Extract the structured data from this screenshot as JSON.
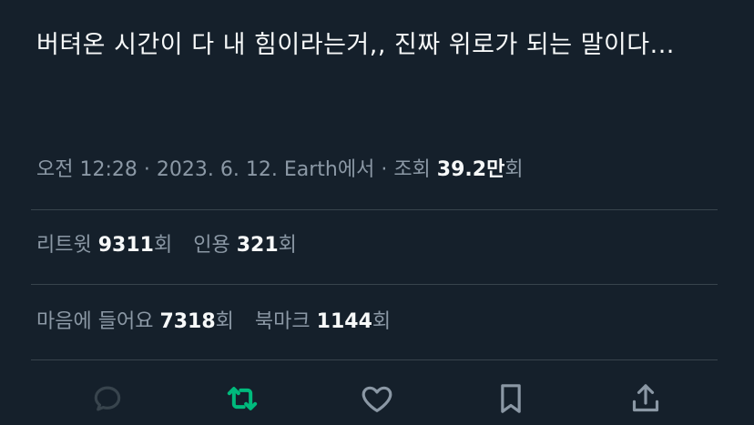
{
  "tweet": {
    "text": "버텨온 시간이 다 내 힘이라는거,, 진짜 위로가 되는 말이다..."
  },
  "meta": {
    "time": "오전 12:28",
    "separator": "·",
    "date": "2023. 6. 12.",
    "source": "Earth에서",
    "views_label": "조회",
    "views_value": "39.2만",
    "views_suffix": "회"
  },
  "stats": {
    "retweets": {
      "label": "리트윗",
      "value": "9311",
      "suffix": "회"
    },
    "quotes": {
      "label": "인용",
      "value": "321",
      "suffix": "회"
    },
    "likes": {
      "label": "마음에 들어요",
      "value": "7318",
      "suffix": "회"
    },
    "bookmarks": {
      "label": "북마크",
      "value": "1144",
      "suffix": "회"
    }
  },
  "actions": {
    "reply_icon": "reply-icon",
    "retweet_icon": "retweet-icon",
    "like_icon": "heart-icon",
    "bookmark_icon": "bookmark-icon",
    "share_icon": "share-icon"
  },
  "colors": {
    "background": "#15202b",
    "text_primary": "#f7f9f9",
    "text_secondary": "#8b98a5",
    "divider": "#38444d",
    "retweet_active": "#00ba7c",
    "reply_icon": "#38444d",
    "icon_default": "#8b98a5"
  }
}
